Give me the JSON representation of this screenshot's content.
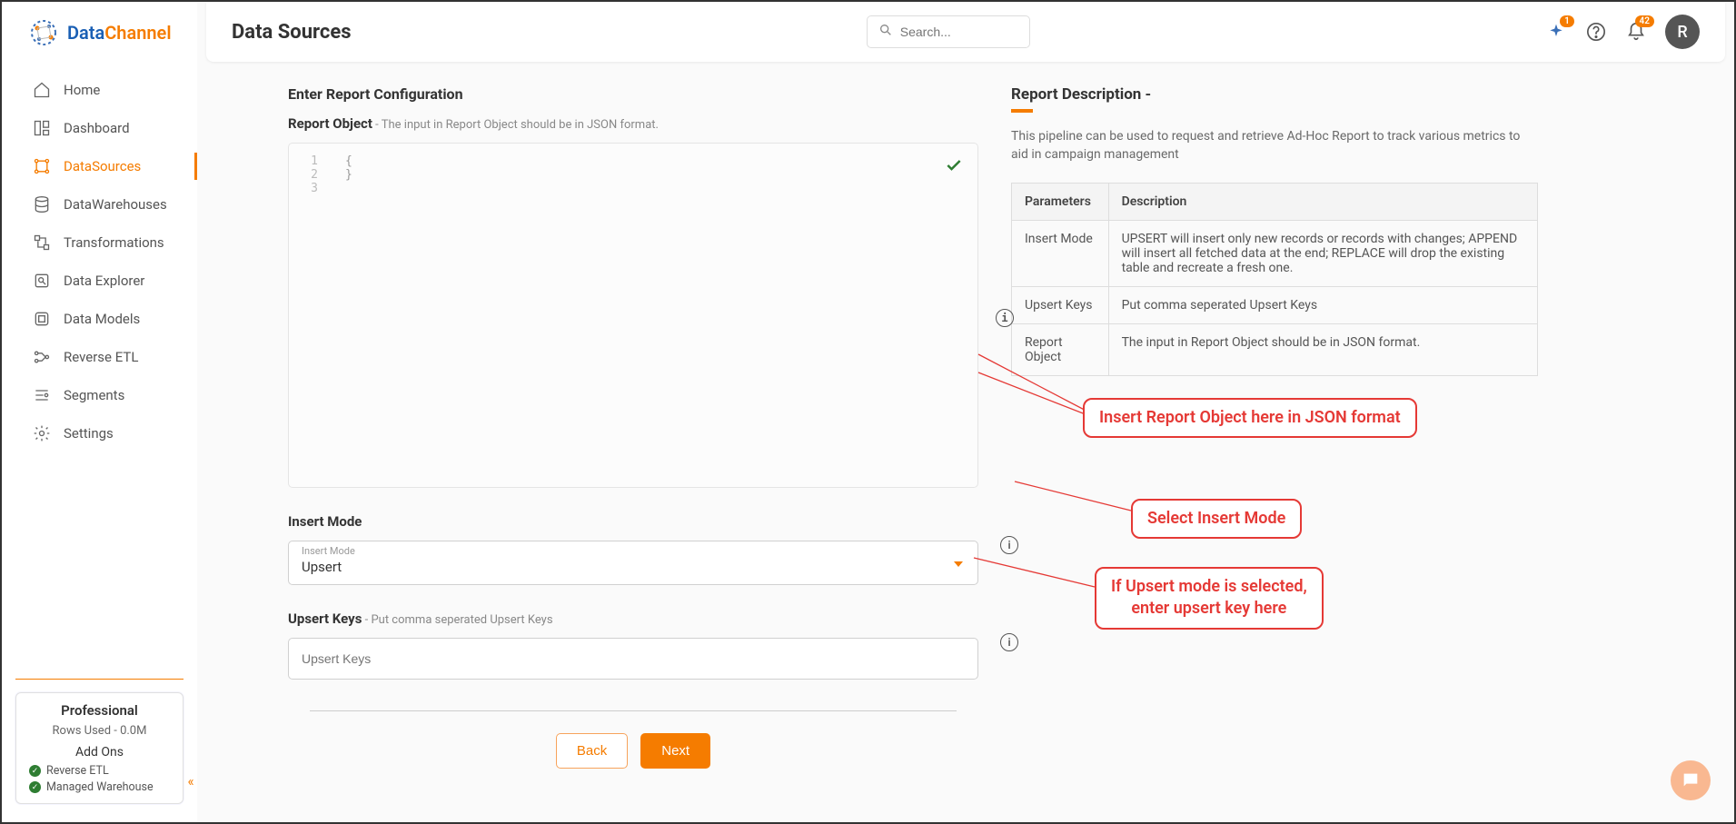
{
  "brand": {
    "part1": "Data",
    "part2": "Channel"
  },
  "nav": {
    "items": [
      {
        "label": "Home"
      },
      {
        "label": "Dashboard"
      },
      {
        "label": "DataSources"
      },
      {
        "label": "DataWarehouses"
      },
      {
        "label": "Transformations"
      },
      {
        "label": "Data Explorer"
      },
      {
        "label": "Data Models"
      },
      {
        "label": "Reverse ETL"
      },
      {
        "label": "Segments"
      },
      {
        "label": "Settings"
      }
    ]
  },
  "plan": {
    "title": "Professional",
    "rows": "Rows Used - 0.0M",
    "addons_label": "Add Ons",
    "addons": [
      {
        "label": "Reverse ETL"
      },
      {
        "label": "Managed Warehouse"
      }
    ]
  },
  "header": {
    "title": "Data Sources",
    "search_placeholder": "Search...",
    "sparkle_badge": "1",
    "bell_badge": "42",
    "avatar": "R"
  },
  "config": {
    "section_title": "Enter Report Configuration",
    "report_object_label": "Report Object",
    "report_object_hint": " - The input in Report Object should be in JSON format.",
    "editor_lines": [
      "1",
      "2",
      "3"
    ],
    "editor_content": [
      "{",
      "}",
      ""
    ],
    "insert_mode_label": "Insert Mode",
    "insert_mode_float": "Insert Mode",
    "insert_mode_value": "Upsert",
    "upsert_keys_label": "Upsert Keys",
    "upsert_keys_hint": " - Put comma seperated Upsert Keys",
    "upsert_keys_placeholder": "Upsert Keys",
    "back_btn": "Back",
    "next_btn": "Next"
  },
  "description": {
    "title": "Report Description -",
    "text": "This pipeline can be used to request and retrieve Ad-Hoc Report to track various metrics to aid in campaign management",
    "table_headers": [
      "Parameters",
      "Description"
    ],
    "rows": [
      {
        "p": "Insert Mode",
        "d": "UPSERT will insert only new records or records with changes; APPEND will insert all fetched data at the end; REPLACE will drop the existing table and recreate a fresh one."
      },
      {
        "p": "Upsert Keys",
        "d": "Put comma seperated Upsert Keys"
      },
      {
        "p": "Report Object",
        "d": "The input in Report Object should be in JSON format."
      }
    ]
  },
  "callouts": {
    "c1": "Insert Report Object here in JSON format",
    "c2": "Select Insert Mode",
    "c3a": "If Upsert mode is selected,",
    "c3b": "enter upsert key here"
  }
}
